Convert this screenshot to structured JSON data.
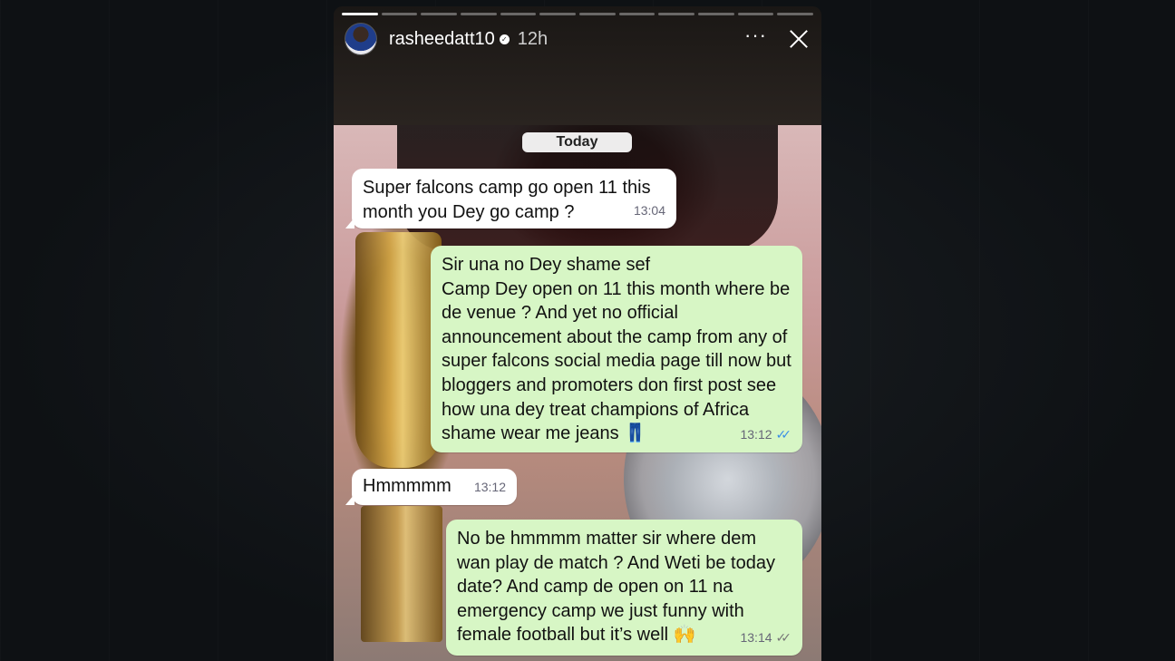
{
  "story": {
    "username": "rasheedatt10",
    "verified_mark": "✓",
    "posted_ago": "12h",
    "more_label": "···",
    "progress_total": 12,
    "progress_done": 1
  },
  "chat": {
    "date_label": "Today",
    "messages": [
      {
        "direction": "incoming",
        "text": "Super falcons camp go open 11 this month you Dey go camp ?",
        "time": "13:04"
      },
      {
        "direction": "outgoing",
        "text": "Sir una no Dey shame sef\nCamp Dey open on 11 this month where be de venue ? And yet no official announcement about the camp from any of super falcons social media page till now but bloggers and promoters don first post see how una dey treat champions of Africa shame wear me jeans 👖",
        "time": "13:12",
        "status": "read"
      },
      {
        "direction": "incoming",
        "text": "Hmmmmm",
        "time": "13:12"
      },
      {
        "direction": "outgoing",
        "text": "No be hmmmm matter sir where dem wan play de match ? And Weti be today date? And camp de open on 11 na emergency camp we just funny with female football but it’s well 🙌",
        "time": "13:14",
        "status": "sent"
      }
    ]
  },
  "colors": {
    "incoming_bubble": "#ffffff",
    "outgoing_bubble": "#d7f6c5",
    "read_tick": "#3a8ee6"
  }
}
